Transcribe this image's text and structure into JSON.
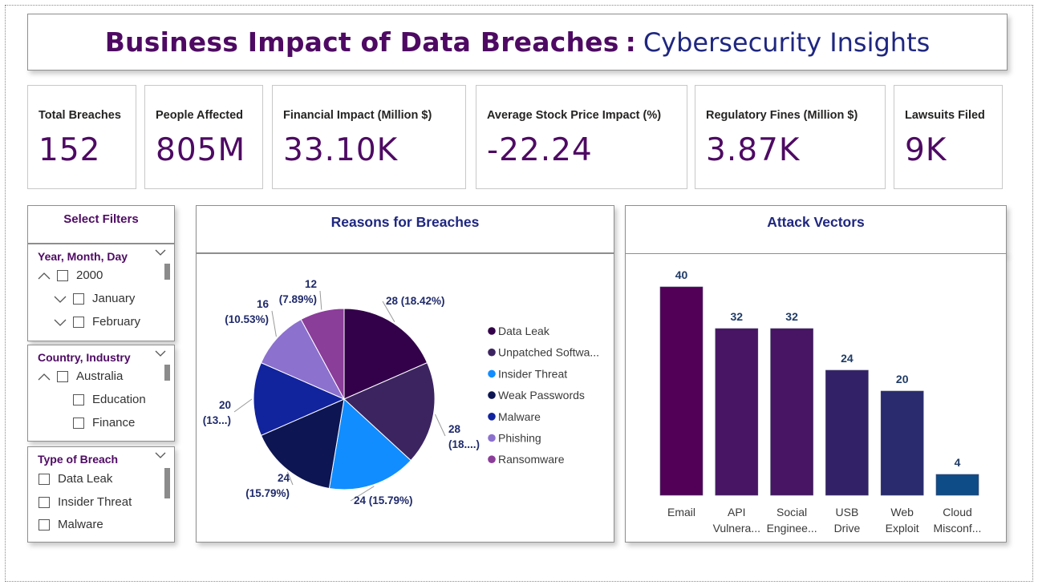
{
  "header": {
    "title": "Business Impact of Data Breaches",
    "separator": ":",
    "subtitle": "Cybersecurity Insights"
  },
  "kpis": [
    {
      "label": "Total Breaches",
      "value": "152"
    },
    {
      "label": "People Affected",
      "value": "805M"
    },
    {
      "label": "Financial Impact (Million $)",
      "value": "33.10K"
    },
    {
      "label": "Average Stock Price Impact (%)",
      "value": "-22.24"
    },
    {
      "label": "Regulatory Fines (Million $)",
      "value": "3.87K"
    },
    {
      "label": "Lawsuits Filed",
      "value": "9K"
    }
  ],
  "filters": {
    "heading": "Select Filters",
    "date": {
      "title": "Year, Month, Day",
      "items": [
        "2000",
        "January",
        "February"
      ]
    },
    "geo": {
      "title": "Country, Industry",
      "items": [
        "Australia",
        "Education",
        "Finance"
      ]
    },
    "breach_type": {
      "title": "Type of Breach",
      "items": [
        "Data Leak",
        "Insider Threat",
        "Malware"
      ]
    }
  },
  "chart_data": [
    {
      "type": "pie",
      "title": "Reasons for Breaches",
      "categories": [
        "Data Leak",
        "Unpatched Software",
        "Insider Threat",
        "Weak Passwords",
        "Malware",
        "Phishing",
        "Ransomware"
      ],
      "legend_labels": [
        "Data Leak",
        "Unpatched Softwa...",
        "Insider Threat",
        "Weak Passwords",
        "Malware",
        "Phishing",
        "Ransomware"
      ],
      "values": [
        28,
        28,
        24,
        24,
        20,
        16,
        12
      ],
      "data_labels": [
        [
          "28 (18.42%)"
        ],
        [
          "28",
          "(18....)"
        ],
        [
          "24 (15.79%)"
        ],
        [
          "24",
          "(15.79%)"
        ],
        [
          "20",
          "(13...)"
        ],
        [
          "16",
          "(10.53%)"
        ],
        [
          "12",
          "(7.89%)"
        ]
      ],
      "colors": [
        "#33004a",
        "#3c2461",
        "#118dff",
        "#0d1552",
        "#12239e",
        "#8c71cf",
        "#8b3d9a"
      ],
      "legend": "right"
    },
    {
      "type": "bar",
      "title": "Attack Vectors",
      "categories": [
        "Email",
        "API Vulnerabilities",
        "Social Engineering",
        "USB Drive",
        "Web Exploit",
        "Cloud Misconfiguration"
      ],
      "tick_labels": [
        [
          "Email"
        ],
        [
          "API",
          "Vulnera..."
        ],
        [
          "Social",
          "Enginee..."
        ],
        [
          "USB",
          "Drive"
        ],
        [
          "Web",
          "Exploit"
        ],
        [
          "Cloud",
          "Misconf..."
        ]
      ],
      "values": [
        40,
        32,
        32,
        24,
        20,
        4
      ],
      "colors": [
        "#520057",
        "#471563",
        "#471563",
        "#332168",
        "#292b6e",
        "#0d4c87"
      ],
      "ylim": [
        0,
        40
      ]
    }
  ]
}
